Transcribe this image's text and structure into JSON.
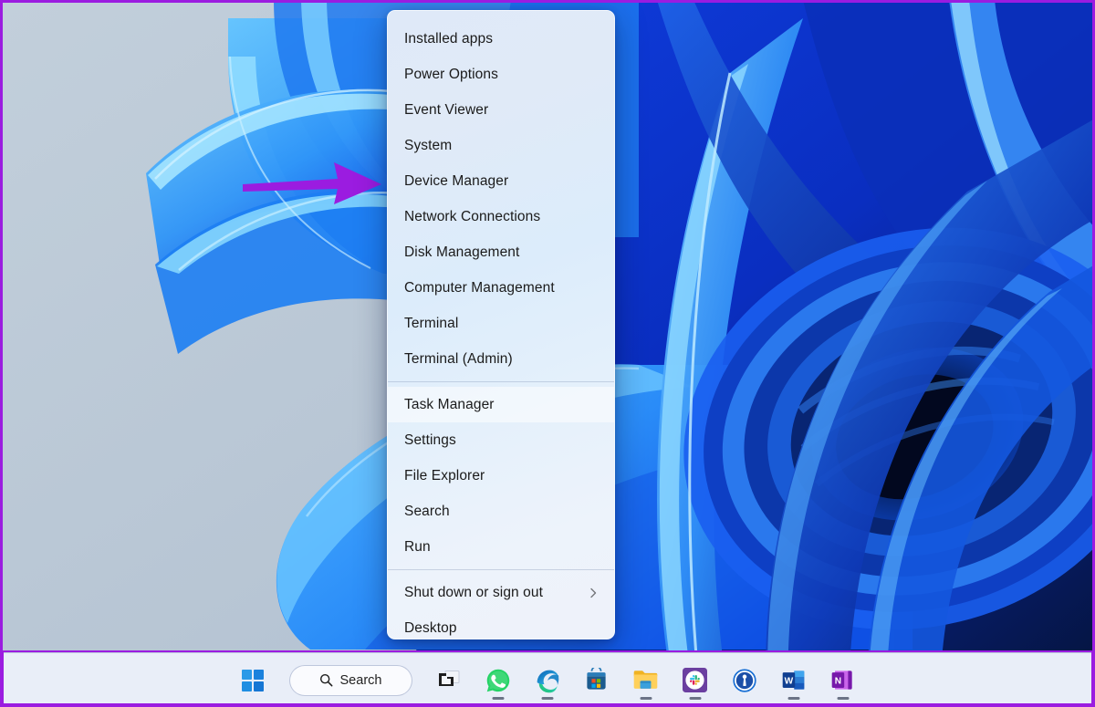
{
  "desktop": {
    "wallpaper_name": "windows-11-bloom-ribbons",
    "wallpaper_colors": {
      "left_flat": "#b9c7d6",
      "mid_blue": "#2a8cf5",
      "deep_blue": "#0b39c8",
      "dark_navy": "#061a5e",
      "highlight": "#7fd0ff"
    }
  },
  "annotation": {
    "arrow_name": "purple-pointer-arrow",
    "arrow_color": "#9b1ce0",
    "points_at": "Device Manager",
    "border_color": "#9b1ce0"
  },
  "winx_menu": {
    "name": "win-x-power-user-menu",
    "background": "#e2ecf9",
    "selected_item": "Task Manager",
    "items": [
      {
        "label": "Installed apps",
        "selected": false,
        "submenu": false,
        "separator_after": false
      },
      {
        "label": "Power Options",
        "selected": false,
        "submenu": false,
        "separator_after": false
      },
      {
        "label": "Event Viewer",
        "selected": false,
        "submenu": false,
        "separator_after": false
      },
      {
        "label": "System",
        "selected": false,
        "submenu": false,
        "separator_after": false
      },
      {
        "label": "Device Manager",
        "selected": false,
        "submenu": false,
        "separator_after": false
      },
      {
        "label": "Network Connections",
        "selected": false,
        "submenu": false,
        "separator_after": false
      },
      {
        "label": "Disk Management",
        "selected": false,
        "submenu": false,
        "separator_after": false
      },
      {
        "label": "Computer Management",
        "selected": false,
        "submenu": false,
        "separator_after": false
      },
      {
        "label": "Terminal",
        "selected": false,
        "submenu": false,
        "separator_after": false
      },
      {
        "label": "Terminal (Admin)",
        "selected": false,
        "submenu": false,
        "separator_after": true
      },
      {
        "label": "Task Manager",
        "selected": true,
        "submenu": false,
        "separator_after": false
      },
      {
        "label": "Settings",
        "selected": false,
        "submenu": false,
        "separator_after": false
      },
      {
        "label": "File Explorer",
        "selected": false,
        "submenu": false,
        "separator_after": false
      },
      {
        "label": "Search",
        "selected": false,
        "submenu": false,
        "separator_after": false
      },
      {
        "label": "Run",
        "selected": false,
        "submenu": false,
        "separator_after": true
      },
      {
        "label": "Shut down or sign out",
        "selected": false,
        "submenu": true,
        "separator_after": false
      },
      {
        "label": "Desktop",
        "selected": false,
        "submenu": false,
        "separator_after": false
      }
    ]
  },
  "taskbar": {
    "background": "#e9eef8",
    "search": {
      "label": "Search",
      "icon": "search-icon"
    },
    "items": [
      {
        "name": "start-button",
        "icon": "windows-logo-icon",
        "label": "Start",
        "running": false
      },
      {
        "name": "task-view-button",
        "icon": "task-view-icon",
        "label": "Task View",
        "running": false
      },
      {
        "name": "whatsapp-button",
        "icon": "whatsapp-icon",
        "label": "WhatsApp",
        "running": true
      },
      {
        "name": "edge-button",
        "icon": "edge-icon",
        "label": "Microsoft Edge",
        "running": true
      },
      {
        "name": "store-button",
        "icon": "microsoft-store-icon",
        "label": "Microsoft Store",
        "running": false
      },
      {
        "name": "file-explorer-button",
        "icon": "folder-icon",
        "label": "File Explorer",
        "running": true
      },
      {
        "name": "slack-button",
        "icon": "slack-icon",
        "label": "Slack",
        "running": true
      },
      {
        "name": "onepassword-button",
        "icon": "onepassword-icon",
        "label": "1Password",
        "running": false
      },
      {
        "name": "word-button",
        "icon": "word-icon",
        "label": "Microsoft Word",
        "running": true
      },
      {
        "name": "onenote-button",
        "icon": "onenote-icon",
        "label": "Microsoft OneNote",
        "running": true
      }
    ]
  }
}
